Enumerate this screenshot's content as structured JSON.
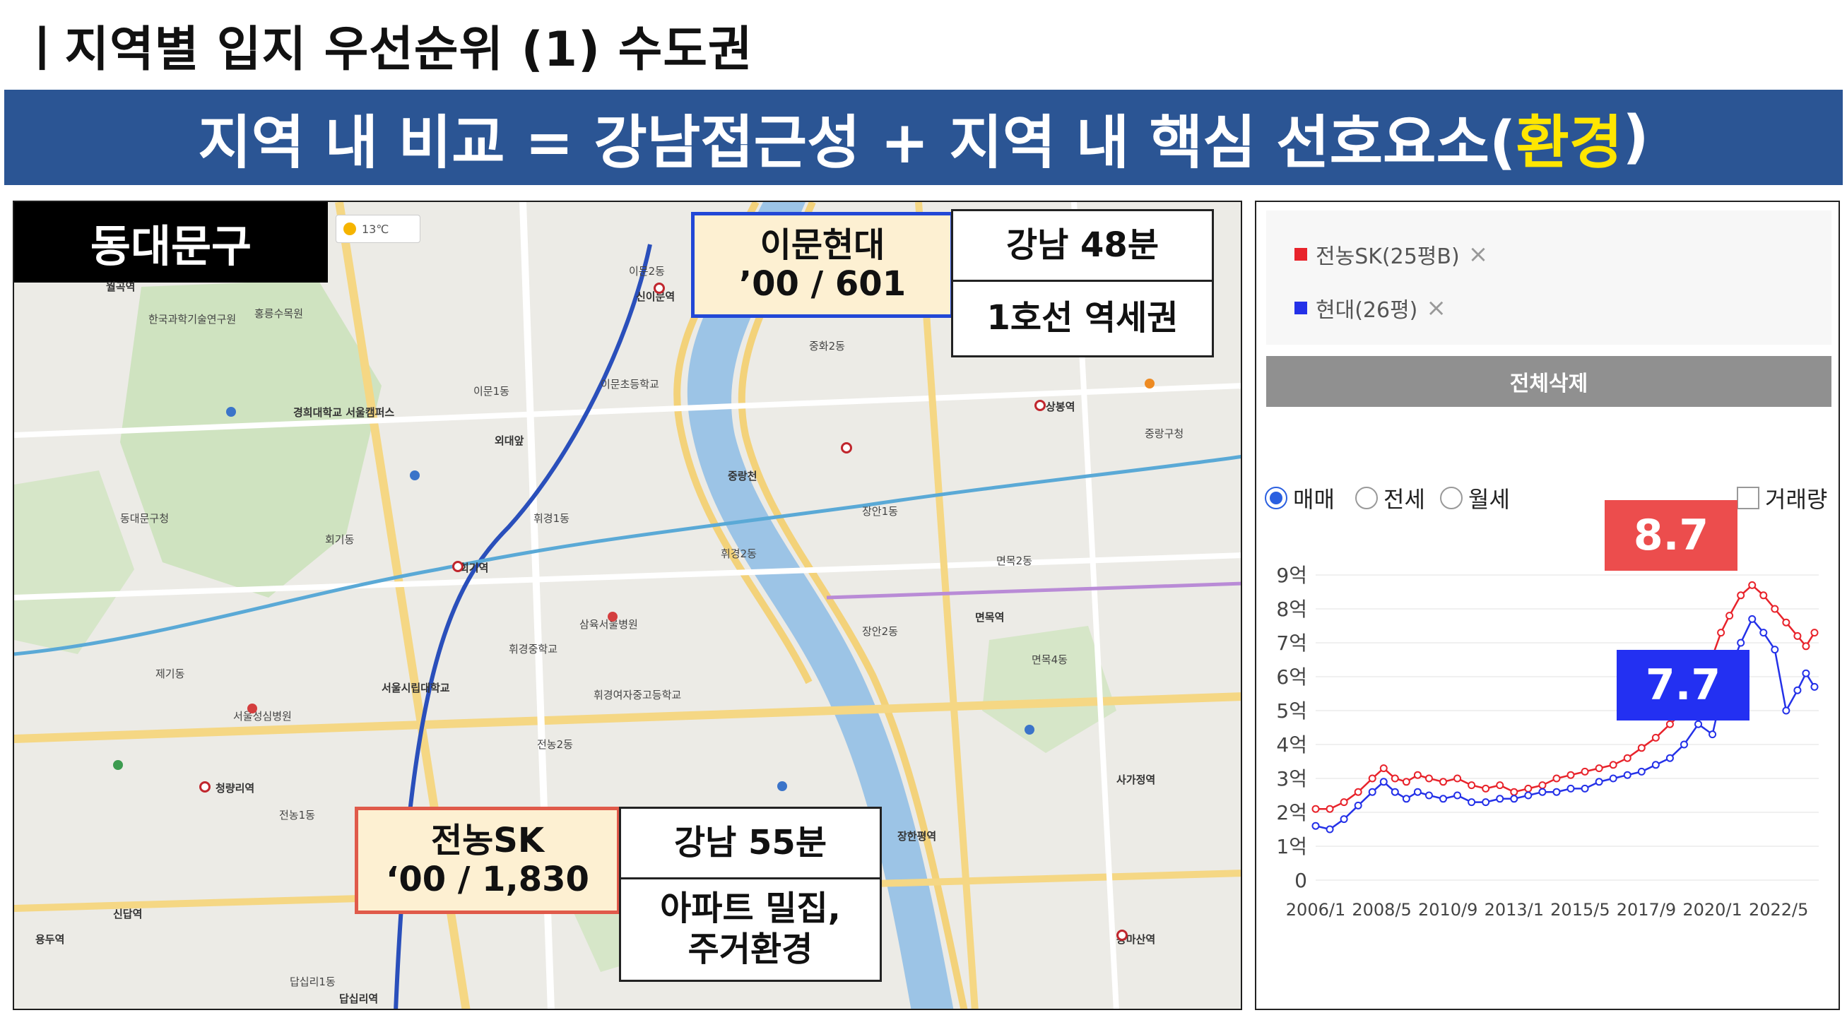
{
  "slide": {
    "title": "ㅣ지역별 입지 우선순위 (1) 수도권",
    "banner_main": "지역 내 비교 = 강남접근성 + 지역 내 핵심 선호요소(",
    "banner_highlight": "환경",
    "banner_end": ")"
  },
  "map": {
    "district": "동대문구",
    "weather": "13℃",
    "labels": [
      "월곡역",
      "홍릉수목원",
      "한국과학기술연구원",
      "경희대학교 서울캠퍼스",
      "외대앞",
      "이문1동",
      "이문2동",
      "신이문역",
      "휘경1동",
      "휘경2동",
      "회기역",
      "회기동",
      "청량리역",
      "전농1동",
      "전농2동",
      "답십리1동",
      "답십리역",
      "장한평역",
      "용두역",
      "신답역",
      "제기동",
      "서울시립대학교",
      "휘경여자중고등학교",
      "중화2동",
      "상봉역",
      "면목역",
      "면목2동",
      "면목4동",
      "사가정역",
      "용마산역",
      "중랑천",
      "동대문구청",
      "삼육서울병원",
      "서울성심병원",
      "휘경중학교",
      "이문초등학교",
      "장안1동",
      "장안2동",
      "중랑구청"
    ],
    "imun_name": "이문현대",
    "imun_meta": "’00 / 601",
    "imun_commute": "강남 48분",
    "imun_line": "1호선 역세권",
    "jeon_name": "전농SK",
    "jeon_meta": "‘00 / 1,830",
    "jeon_commute": "강남 55분",
    "jeon_feat1": "아파트 밀집,",
    "jeon_feat2": "주거환경"
  },
  "chart_ui": {
    "legend1": "전농SK(25평B)",
    "legend2": "현대(26평)",
    "remove_icon": "×",
    "clear_all": "전체삭제",
    "radio1": "매매",
    "radio2": "전세",
    "radio3": "월세",
    "volume": "거래량",
    "red_peak": "8.7",
    "blue_peak": "7.7",
    "colors": {
      "red": "#e8232b",
      "blue": "#2431e8"
    }
  },
  "chart_data": {
    "type": "line",
    "ylabel": "",
    "xlabel": "",
    "yticks": [
      "9억",
      "8억",
      "7억",
      "6억",
      "5억",
      "4억",
      "3억",
      "2억",
      "1억",
      "0"
    ],
    "ylim": [
      0,
      9
    ],
    "xticks": [
      "2006/1",
      "2008/5",
      "2010/9",
      "2013/1",
      "2015/5",
      "2017/9",
      "2020/1",
      "2022/5"
    ],
    "xlim": [
      2006.0,
      2023.75
    ],
    "series": [
      {
        "name": "전농SK(25평B)",
        "color": "#e8232b",
        "x": [
          2006.0,
          2006.5,
          2007.0,
          2007.5,
          2008.0,
          2008.4,
          2008.8,
          2009.2,
          2009.6,
          2010.0,
          2010.5,
          2011.0,
          2011.5,
          2012.0,
          2012.5,
          2013.0,
          2013.5,
          2014.0,
          2014.5,
          2015.0,
          2015.5,
          2016.0,
          2016.5,
          2017.0,
          2017.5,
          2018.0,
          2018.5,
          2019.0,
          2019.5,
          2020.0,
          2020.3,
          2020.6,
          2021.0,
          2021.4,
          2021.8,
          2022.2,
          2022.6,
          2023.0,
          2023.3,
          2023.6
        ],
        "y": [
          2.1,
          2.1,
          2.3,
          2.6,
          3.0,
          3.3,
          3.0,
          2.9,
          3.1,
          3.0,
          2.9,
          3.0,
          2.8,
          2.7,
          2.8,
          2.6,
          2.7,
          2.8,
          3.0,
          3.1,
          3.2,
          3.3,
          3.4,
          3.6,
          3.9,
          4.2,
          4.6,
          5.0,
          5.6,
          6.6,
          7.3,
          7.8,
          8.4,
          8.7,
          8.4,
          8.0,
          7.6,
          7.2,
          6.9,
          7.3
        ]
      },
      {
        "name": "현대(26평)",
        "color": "#2431e8",
        "x": [
          2006.0,
          2006.5,
          2007.0,
          2007.5,
          2008.0,
          2008.4,
          2008.8,
          2009.2,
          2009.6,
          2010.0,
          2010.5,
          2011.0,
          2011.5,
          2012.0,
          2012.5,
          2013.0,
          2013.5,
          2014.0,
          2014.5,
          2015.0,
          2015.5,
          2016.0,
          2016.5,
          2017.0,
          2017.5,
          2018.0,
          2018.5,
          2019.0,
          2019.5,
          2020.0,
          2020.3,
          2020.6,
          2021.0,
          2021.4,
          2021.8,
          2022.2,
          2022.6,
          2023.0,
          2023.3,
          2023.6
        ],
        "y": [
          1.6,
          1.5,
          1.8,
          2.2,
          2.6,
          2.9,
          2.6,
          2.4,
          2.6,
          2.5,
          2.4,
          2.5,
          2.3,
          2.3,
          2.4,
          2.4,
          2.5,
          2.6,
          2.6,
          2.7,
          2.7,
          2.9,
          3.0,
          3.1,
          3.2,
          3.4,
          3.6,
          4.0,
          4.6,
          4.3,
          5.4,
          6.2,
          7.0,
          7.7,
          7.3,
          6.8,
          5.0,
          5.6,
          6.1,
          5.7
        ]
      }
    ]
  }
}
